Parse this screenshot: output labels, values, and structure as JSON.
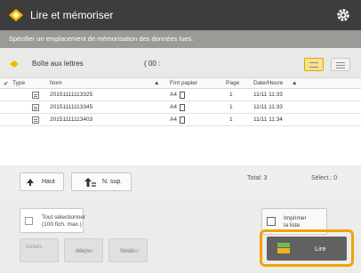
{
  "header": {
    "title": "Lire et mémoriser",
    "subtitle": "Spécifier un emplacement de mémorisation des données lues."
  },
  "mailbox": {
    "label": "Boîte aux lettres",
    "count": "( 00 :"
  },
  "table": {
    "headers": {
      "type": "Type",
      "name": "Nom",
      "paper": "Fmt papier",
      "pages": "Page",
      "datetime": "Date/Heure"
    },
    "rows": [
      {
        "name": "20151111113325",
        "paper": "A4",
        "pages": "1",
        "datetime": "11/11 11:33"
      },
      {
        "name": "20151111113345",
        "paper": "A4",
        "pages": "1",
        "datetime": "11/11 11:33"
      },
      {
        "name": "20151111113403",
        "paper": "A4",
        "pages": "1",
        "datetime": "11/11 11:34"
      }
    ]
  },
  "nav": {
    "up": "Haut",
    "up_level": "N. sup.",
    "total": "Total: 3",
    "selected": "Sélect.: 0"
  },
  "actions": {
    "select_all_line1": "Tout sélectionner",
    "select_all_line2": "(100 fich. max.)",
    "print_list_line1": "Imprimer",
    "print_list_line2": "la liste",
    "details": "Détails",
    "display_image_line1": "Afficher",
    "display_image_line2": "image",
    "edit_file_line1": "Modifier",
    "edit_file_line2": "fichier",
    "read": "Lire"
  },
  "colors": {
    "accent": "#f0a30a",
    "titlebar": "#3d3d3d",
    "subtitle_bar": "#9a9a96"
  }
}
